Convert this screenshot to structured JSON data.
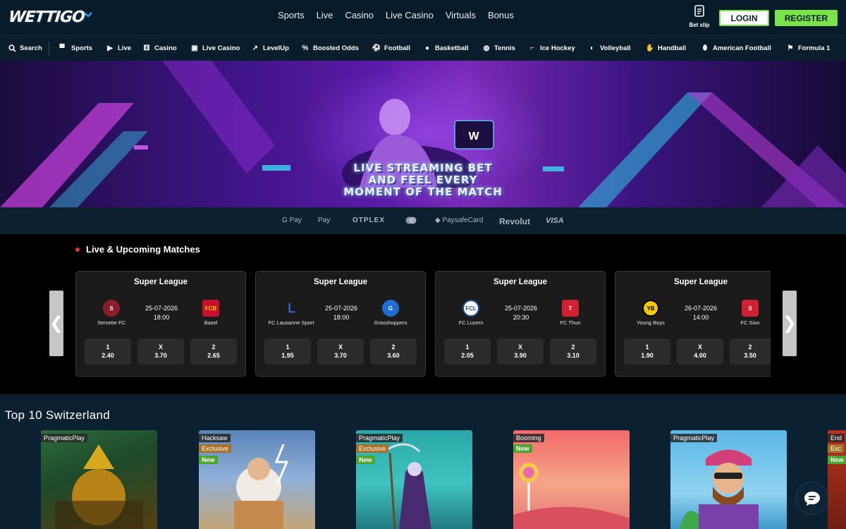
{
  "header": {
    "logo_text": "WETTIGO",
    "nav": [
      "Sports",
      "Live",
      "Casino",
      "Live Casino",
      "Virtuals",
      "Bonus"
    ],
    "betslip_label": "Bet slip",
    "login_label": "LOGIN",
    "register_label": "REGISTER",
    "accent_green": "#7ae34b"
  },
  "categories": [
    {
      "label": "Search",
      "icon": "search-icon"
    },
    {
      "label": "Sports",
      "icon": "stadium-icon"
    },
    {
      "label": "Live",
      "icon": "live-icon"
    },
    {
      "label": "Casino",
      "icon": "dice-icon"
    },
    {
      "label": "Live Casino",
      "icon": "cards-icon"
    },
    {
      "label": "LevelUp",
      "icon": "levelup-icon"
    },
    {
      "label": "Boosted Odds",
      "icon": "percent-icon"
    },
    {
      "label": "Football",
      "icon": "football-icon"
    },
    {
      "label": "Basketball",
      "icon": "basketball-icon"
    },
    {
      "label": "Tennis",
      "icon": "tennis-icon"
    },
    {
      "label": "Ice Hockey",
      "icon": "hockey-icon"
    },
    {
      "label": "Volleyball",
      "icon": "volleyball-icon"
    },
    {
      "label": "Handball",
      "icon": "handball-icon"
    },
    {
      "label": "American Football",
      "icon": "american-football-icon"
    },
    {
      "label": "Formula 1",
      "icon": "flag-icon"
    }
  ],
  "banner": {
    "title": "LIVE STREAMING BET\nAND FEEL EVERY\nMOMENT OF THE MATCH"
  },
  "payments": [
    "G Pay",
    "Pay",
    "OTPLEX",
    "mastercard",
    "PaysafeCard",
    "Revolut",
    "VISA"
  ],
  "matches": {
    "title": "Live & Upcoming Matches",
    "cards": [
      {
        "league": "Super League",
        "home": "Servette FC",
        "away": "Basel",
        "date": "25-07-2026",
        "time": "18:00",
        "odds": [
          {
            "k": "1",
            "v": "2.40"
          },
          {
            "k": "X",
            "v": "3.70"
          },
          {
            "k": "2",
            "v": "2.65"
          }
        ]
      },
      {
        "league": "Super League",
        "home": "FC Lausanne Sport",
        "away": "Grasshoppers",
        "date": "25-07-2026",
        "time": "18:00",
        "odds": [
          {
            "k": "1",
            "v": "1.95"
          },
          {
            "k": "X",
            "v": "3.70"
          },
          {
            "k": "2",
            "v": "3.60"
          }
        ]
      },
      {
        "league": "Super League",
        "home": "FC Luzern",
        "away": "FC Thun",
        "date": "25-07-2026",
        "time": "20:30",
        "odds": [
          {
            "k": "1",
            "v": "2.05"
          },
          {
            "k": "X",
            "v": "3.90"
          },
          {
            "k": "2",
            "v": "3.10"
          }
        ]
      },
      {
        "league": "Super League",
        "home": "Young Boys",
        "away": "FC Sion",
        "date": "26-07-2026",
        "time": "14:00",
        "odds": [
          {
            "k": "1",
            "v": "1.90"
          },
          {
            "k": "X",
            "v": "4.00"
          },
          {
            "k": "2",
            "v": "3.50"
          }
        ]
      }
    ]
  },
  "top10": {
    "title": "Top 10 Switzerland",
    "games": [
      {
        "provider": "PragmaticPlay",
        "tags": []
      },
      {
        "provider": "Hacksaw",
        "tags": [
          "Exclusive",
          "New"
        ]
      },
      {
        "provider": "PragmaticPlay",
        "tags": [
          "Exclusive",
          "New"
        ]
      },
      {
        "provider": "Booming",
        "tags": [
          "New"
        ]
      },
      {
        "provider": "PragmaticPlay",
        "tags": []
      },
      {
        "provider": "End",
        "tags": [
          "Exc",
          "New"
        ]
      }
    ]
  }
}
